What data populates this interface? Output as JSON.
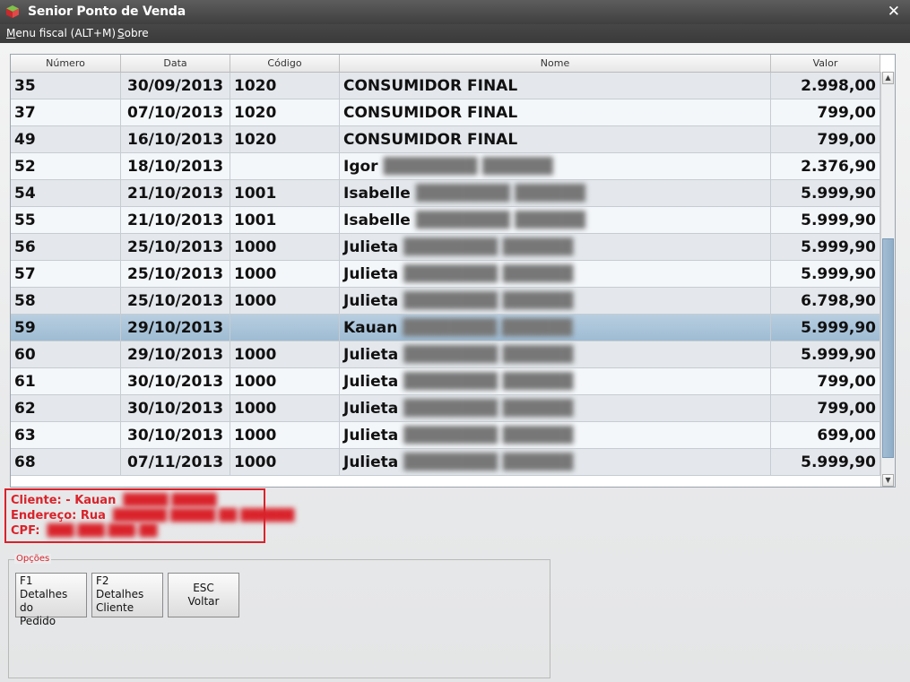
{
  "window": {
    "title": "Senior Ponto de Venda",
    "close_glyph": "✕"
  },
  "menu": {
    "fiscal": {
      "underlined": "M",
      "rest": "enu fiscal (ALT+M)"
    },
    "sobre": {
      "underlined": "S",
      "rest": "obre"
    }
  },
  "grid": {
    "columns": [
      "Número",
      "Data",
      "Código",
      "Nome",
      "Valor"
    ],
    "rows": [
      {
        "numero": "35",
        "data": "30/09/2013",
        "codigo": "1020",
        "nome": "CONSUMIDOR FINAL",
        "valor": "2.998,00"
      },
      {
        "numero": "37",
        "data": "07/10/2013",
        "codigo": "1020",
        "nome": "CONSUMIDOR FINAL",
        "valor": "799,00"
      },
      {
        "numero": "49",
        "data": "16/10/2013",
        "codigo": "1020",
        "nome": "CONSUMIDOR FINAL",
        "valor": "799,00"
      },
      {
        "numero": "52",
        "data": "18/10/2013",
        "codigo": "",
        "nome": "Igor",
        "valor": "2.376,90"
      },
      {
        "numero": "54",
        "data": "21/10/2013",
        "codigo": "1001",
        "nome": "Isabelle",
        "valor": "5.999,90"
      },
      {
        "numero": "55",
        "data": "21/10/2013",
        "codigo": "1001",
        "nome": "Isabelle",
        "valor": "5.999,90"
      },
      {
        "numero": "56",
        "data": "25/10/2013",
        "codigo": "1000",
        "nome": "Julieta",
        "valor": "5.999,90"
      },
      {
        "numero": "57",
        "data": "25/10/2013",
        "codigo": "1000",
        "nome": "Julieta",
        "valor": "5.999,90"
      },
      {
        "numero": "58",
        "data": "25/10/2013",
        "codigo": "1000",
        "nome": "Julieta",
        "valor": "6.798,90"
      },
      {
        "numero": "59",
        "data": "29/10/2013",
        "codigo": "",
        "nome": "Kauan",
        "valor": "5.999,90",
        "selected": true
      },
      {
        "numero": "60",
        "data": "29/10/2013",
        "codigo": "1000",
        "nome": "Julieta",
        "valor": "5.999,90"
      },
      {
        "numero": "61",
        "data": "30/10/2013",
        "codigo": "1000",
        "nome": "Julieta",
        "valor": "799,00"
      },
      {
        "numero": "62",
        "data": "30/10/2013",
        "codigo": "1000",
        "nome": "Julieta",
        "valor": "799,00"
      },
      {
        "numero": "63",
        "data": "30/10/2013",
        "codigo": "1000",
        "nome": "Julieta",
        "valor": "699,00"
      },
      {
        "numero": "68",
        "data": "07/11/2013",
        "codigo": "1000",
        "nome": "Julieta",
        "valor": "5.999,90"
      }
    ]
  },
  "info": {
    "cliente_label": "Cliente: - Kauan",
    "endereco_label": "Endereço: Rua",
    "cpf_label": "CPF:"
  },
  "options": {
    "legend": "Opções",
    "buttons": [
      {
        "key": "F1",
        "line1": "Detalhes do",
        "line2": "Pedido"
      },
      {
        "key": "F2",
        "line1": "Detalhes",
        "line2": "Cliente"
      },
      {
        "key": "ESC",
        "line1": "Voltar"
      }
    ]
  },
  "colors": {
    "accent_red": "#d9232b",
    "selected_row": "#a9c4da",
    "titlebar": "#4a4a4a"
  }
}
